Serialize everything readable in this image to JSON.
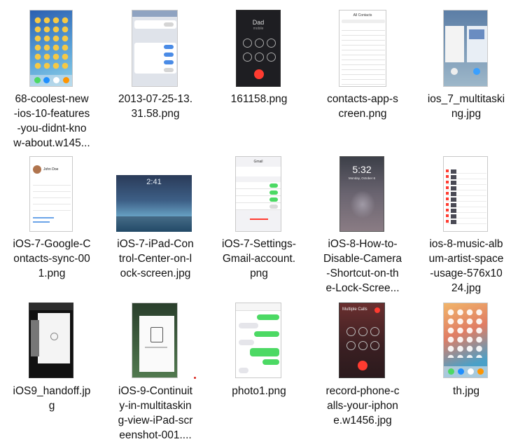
{
  "files": [
    {
      "lines": [
        "68-coolest-new",
        "-ios-10-features",
        "-you-didnt-kno",
        "w-about.w145..."
      ],
      "icon": "ios-home-screen-thumbnail"
    },
    {
      "lines": [
        "2013-07-25-13.",
        "31.58.png"
      ],
      "icon": "messages-settings-thumbnail"
    },
    {
      "lines": [
        "161158.png"
      ],
      "icon": "phone-call-screen-thumbnail",
      "caller": "Dad",
      "caller_sub": "mobile"
    },
    {
      "lines": [
        "contacts-app-s",
        "creen.png"
      ],
      "icon": "contacts-list-thumbnail",
      "title": "All Contacts"
    },
    {
      "lines": [
        "ios_7_multitaski",
        "ng.jpg"
      ],
      "icon": "multitasking-thumbnail"
    },
    {
      "lines": [
        "iOS-7-Google-C",
        "ontacts-sync-00",
        "1.png"
      ],
      "icon": "contact-card-thumbnail",
      "name": "John Doe"
    },
    {
      "lines": [
        "iOS-7-iPad-Con",
        "trol-Center-on-l",
        "ock-screen.jpg"
      ],
      "icon": "ipad-lock-screen-thumbnail",
      "time": "2:41"
    },
    {
      "lines": [
        "iOS-7-Settings-",
        "Gmail-account.",
        "png"
      ],
      "icon": "gmail-settings-thumbnail",
      "title": "Gmail"
    },
    {
      "lines": [
        "iOS-8-How-to-",
        "Disable-Camera",
        "-Shortcut-on-th",
        "e-Lock-Scree..."
      ],
      "icon": "lock-screen-thumbnail",
      "time": "5:32",
      "date": "Monday, October 6"
    },
    {
      "lines": [
        "ios-8-music-alb",
        "um-artist-space",
        "-usage-576x10",
        "24.jpg"
      ],
      "icon": "music-usage-thumbnail"
    },
    {
      "lines": [
        "iOS9_handoff.jp",
        "g"
      ],
      "icon": "handoff-thumbnail"
    },
    {
      "lines": [
        "iOS-9-Continuit",
        "y-in-multitaskin",
        "g-view-iPad-scr",
        "eenshot-001...."
      ],
      "icon": "ipad-multitasking-thumbnail"
    },
    {
      "lines": [
        "photo1.png"
      ],
      "icon": "messages-conversation-thumbnail"
    },
    {
      "lines": [
        "record-phone-c",
        "alls-your-iphon",
        "e.w1456.jpg"
      ],
      "icon": "multiple-calls-thumbnail",
      "title": "Multiple Calls"
    },
    {
      "lines": [
        "th.jpg"
      ],
      "icon": "ios-home-screen-thumbnail-2"
    }
  ],
  "colors": {
    "ios_green": "#4cd964",
    "ios_red": "#ff3b30",
    "ios_blue": "#007aff",
    "text": "#111111"
  }
}
